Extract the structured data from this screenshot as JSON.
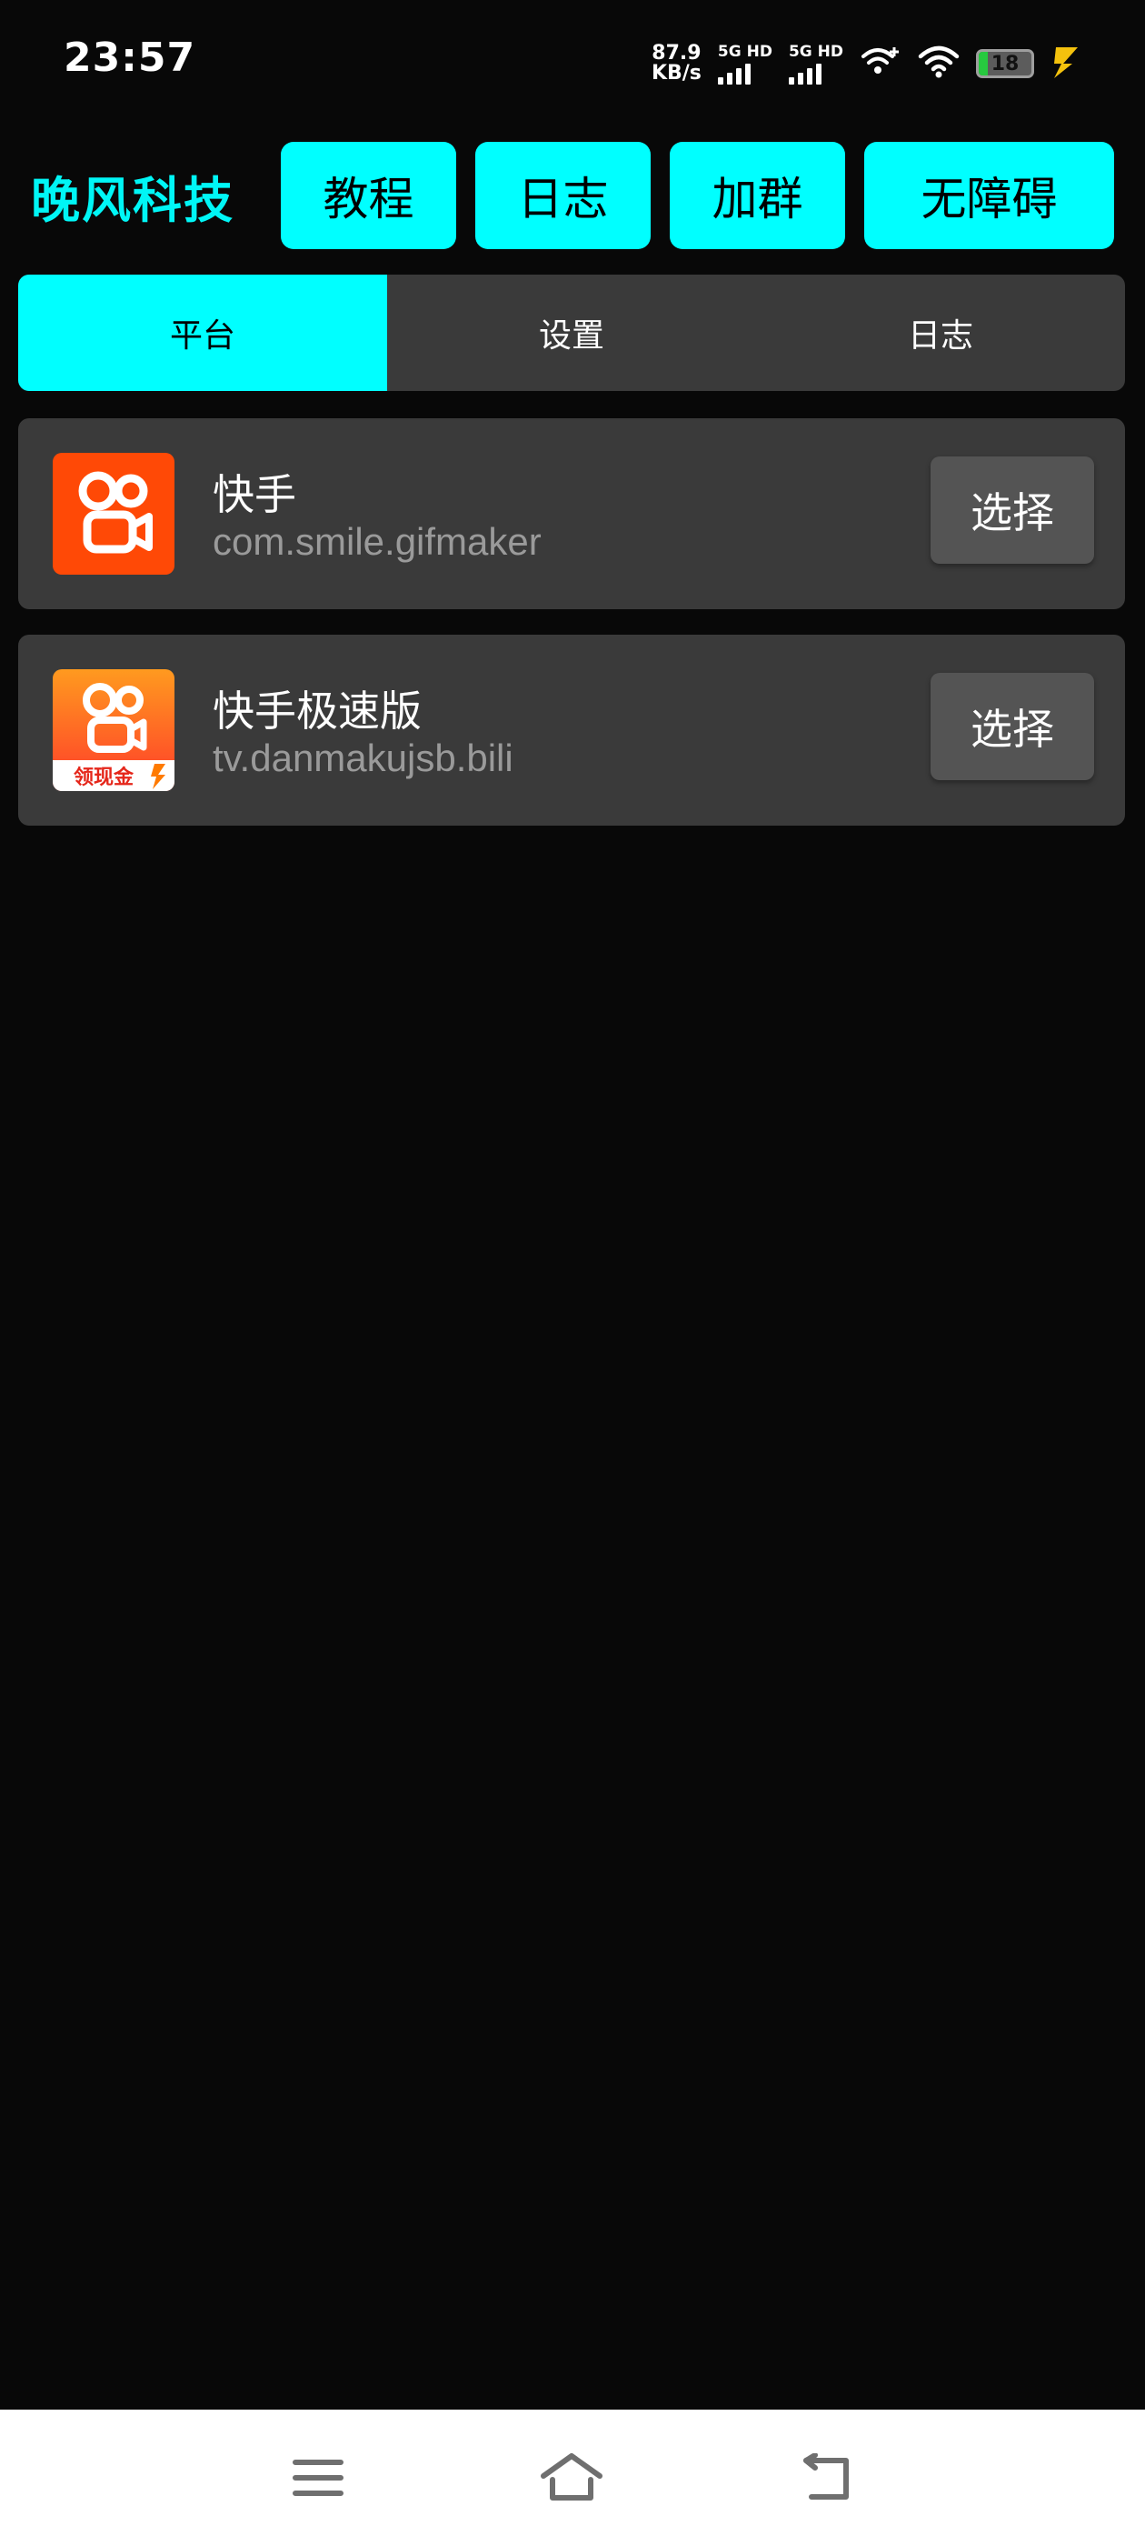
{
  "status_bar": {
    "time": "23:57",
    "net_speed_value": "87.9",
    "net_speed_unit": "KB/s",
    "sim1_label": "5G HD",
    "sim2_label": "5G HD",
    "battery_level": "18",
    "battery_fill_percent": 18,
    "icons": [
      "wifi-plus-icon",
      "wifi-icon",
      "battery-icon",
      "charging-bolt-icon"
    ]
  },
  "header": {
    "title": "晚风科技",
    "buttons": [
      {
        "label": "教程"
      },
      {
        "label": "日志"
      },
      {
        "label": "加群"
      },
      {
        "label": "无障碍"
      }
    ],
    "accent_color": "#00ffff"
  },
  "tabs": {
    "items": [
      {
        "label": "平台",
        "active": true
      },
      {
        "label": "设置",
        "active": false
      },
      {
        "label": "日志",
        "active": false
      }
    ]
  },
  "apps": [
    {
      "name": "快手",
      "package": "com.smile.gifmaker",
      "select_label": "选择",
      "icon": "kuaishou-icon"
    },
    {
      "name": "快手极速版",
      "package": "tv.danmakujsb.bili",
      "select_label": "选择",
      "icon": "kuaishou-lite-icon",
      "icon_badge": "领现金"
    }
  ],
  "nav_bar": {
    "icons": [
      "menu-icon",
      "home-icon",
      "back-icon"
    ]
  }
}
